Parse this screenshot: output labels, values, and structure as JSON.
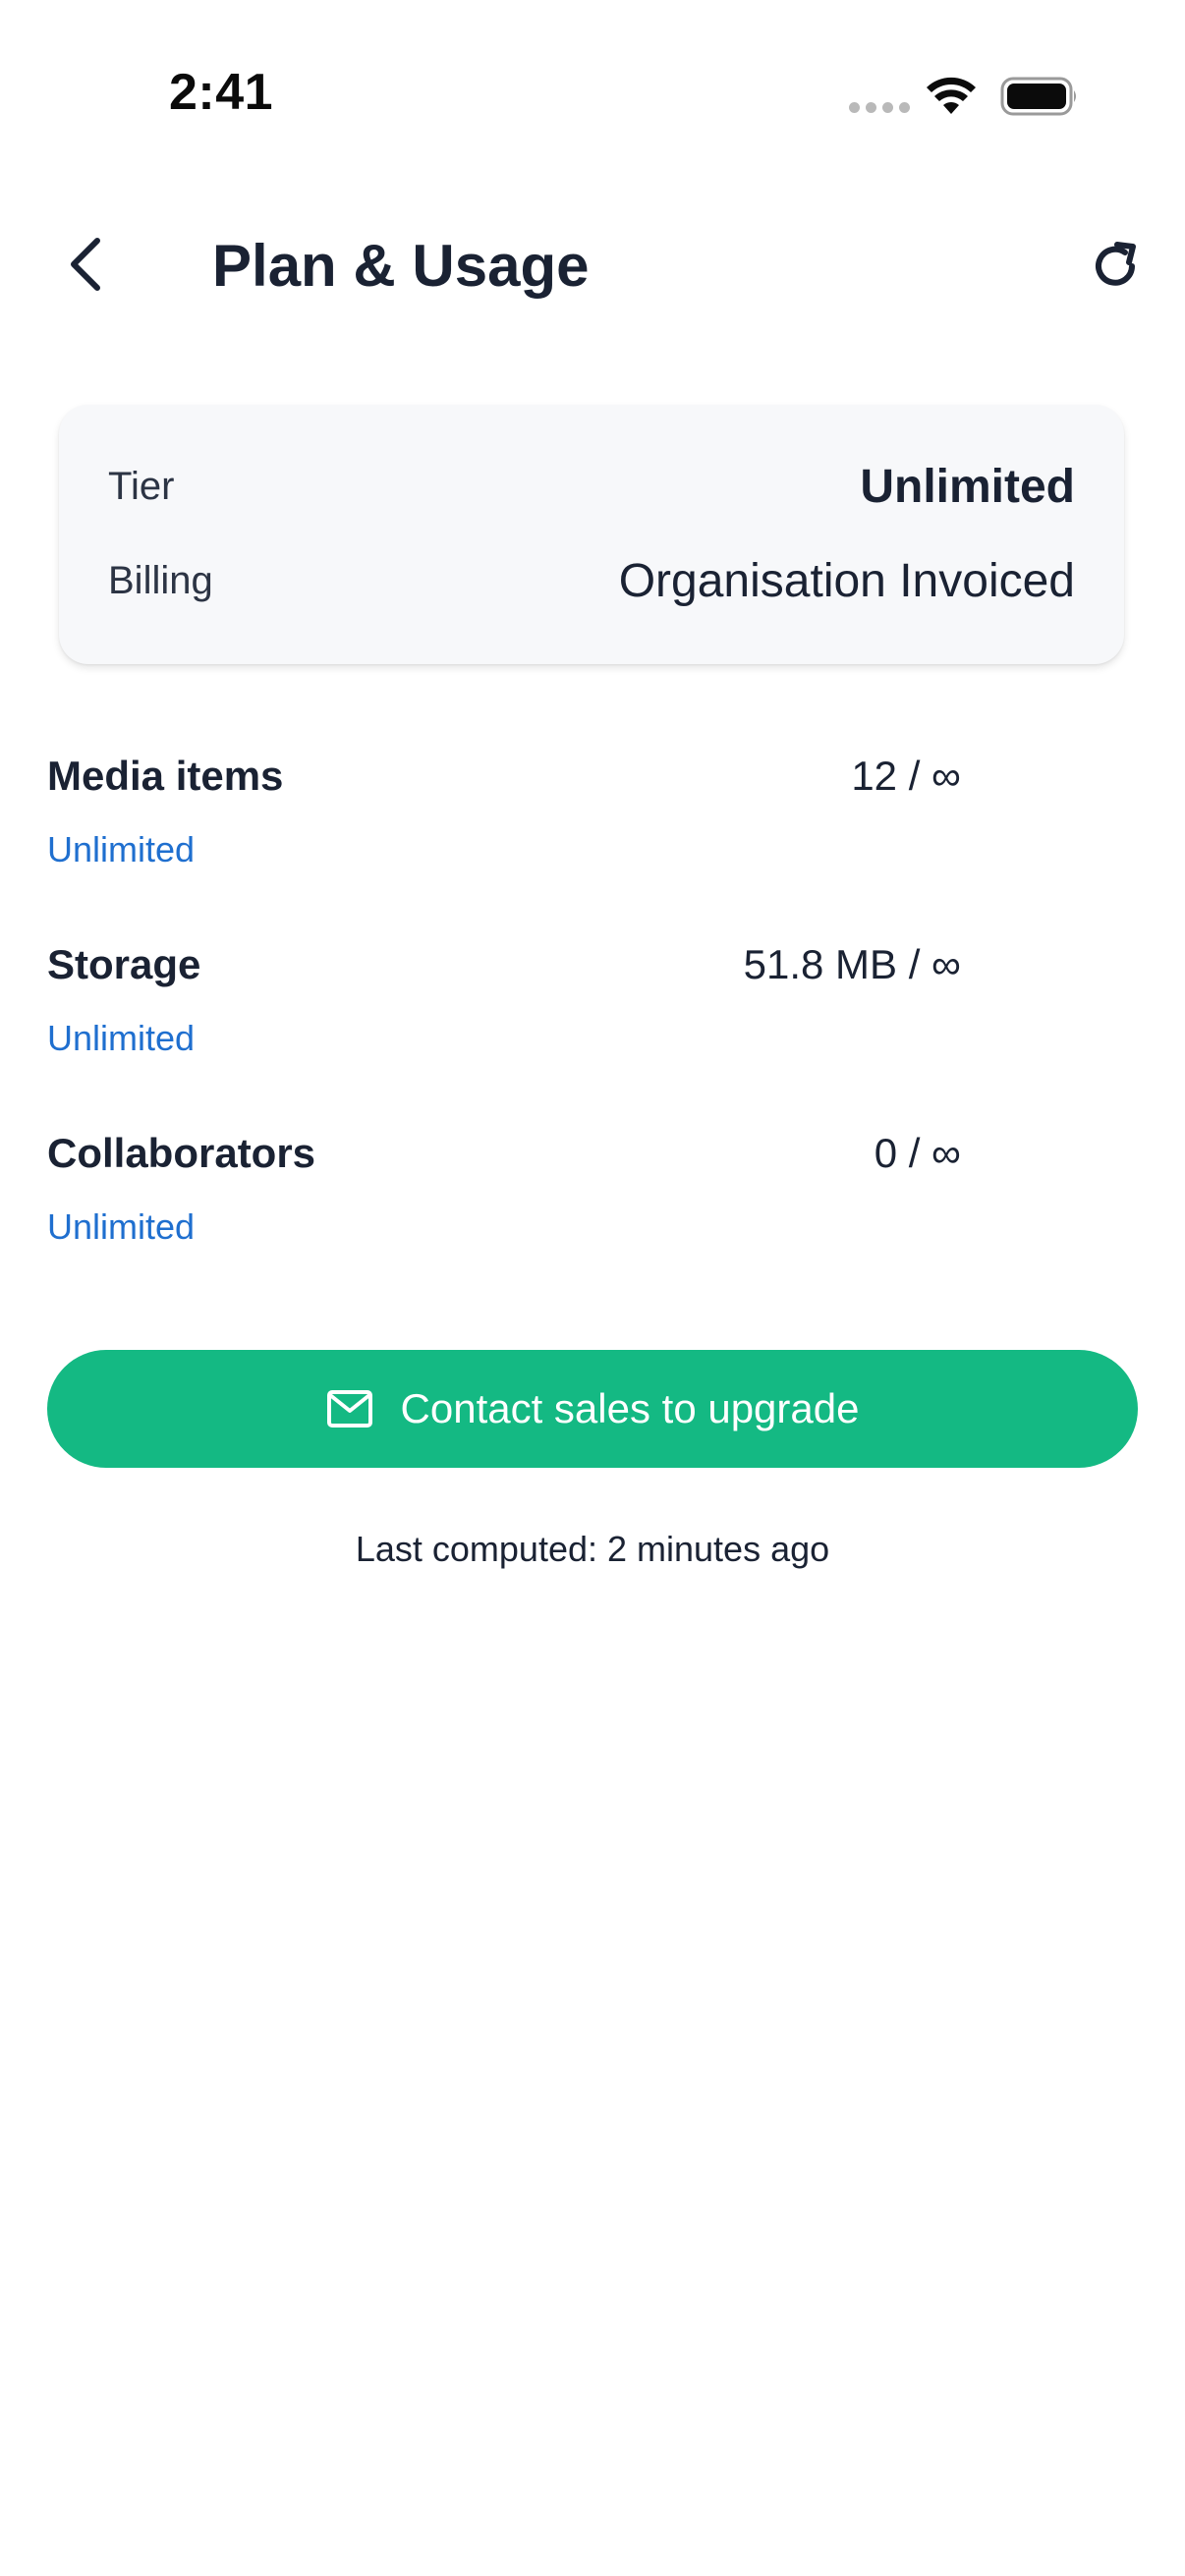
{
  "status_bar": {
    "time": "2:41"
  },
  "header": {
    "title": "Plan & Usage",
    "back_icon": "chevron-left-icon",
    "refresh_icon": "refresh-icon"
  },
  "plan": {
    "tier_label": "Tier",
    "tier_value": "Unlimited",
    "billing_label": "Billing",
    "billing_value": "Organisation Invoiced"
  },
  "usage": [
    {
      "name": "Media items",
      "count": "12 / ∞",
      "limit": "Unlimited"
    },
    {
      "name": "Storage",
      "count": "51.8 MB / ∞",
      "limit": "Unlimited"
    },
    {
      "name": "Collaborators",
      "count": "0 / ∞",
      "limit": "Unlimited"
    }
  ],
  "cta": {
    "label": "Contact sales to upgrade",
    "icon": "mail-icon"
  },
  "footnote": "Last computed: 2 minutes ago",
  "colors": {
    "accent_green": "#14b983",
    "link_blue": "#1f6fcf",
    "text_dark": "#1a2233",
    "card_bg": "#f7f8fa"
  }
}
